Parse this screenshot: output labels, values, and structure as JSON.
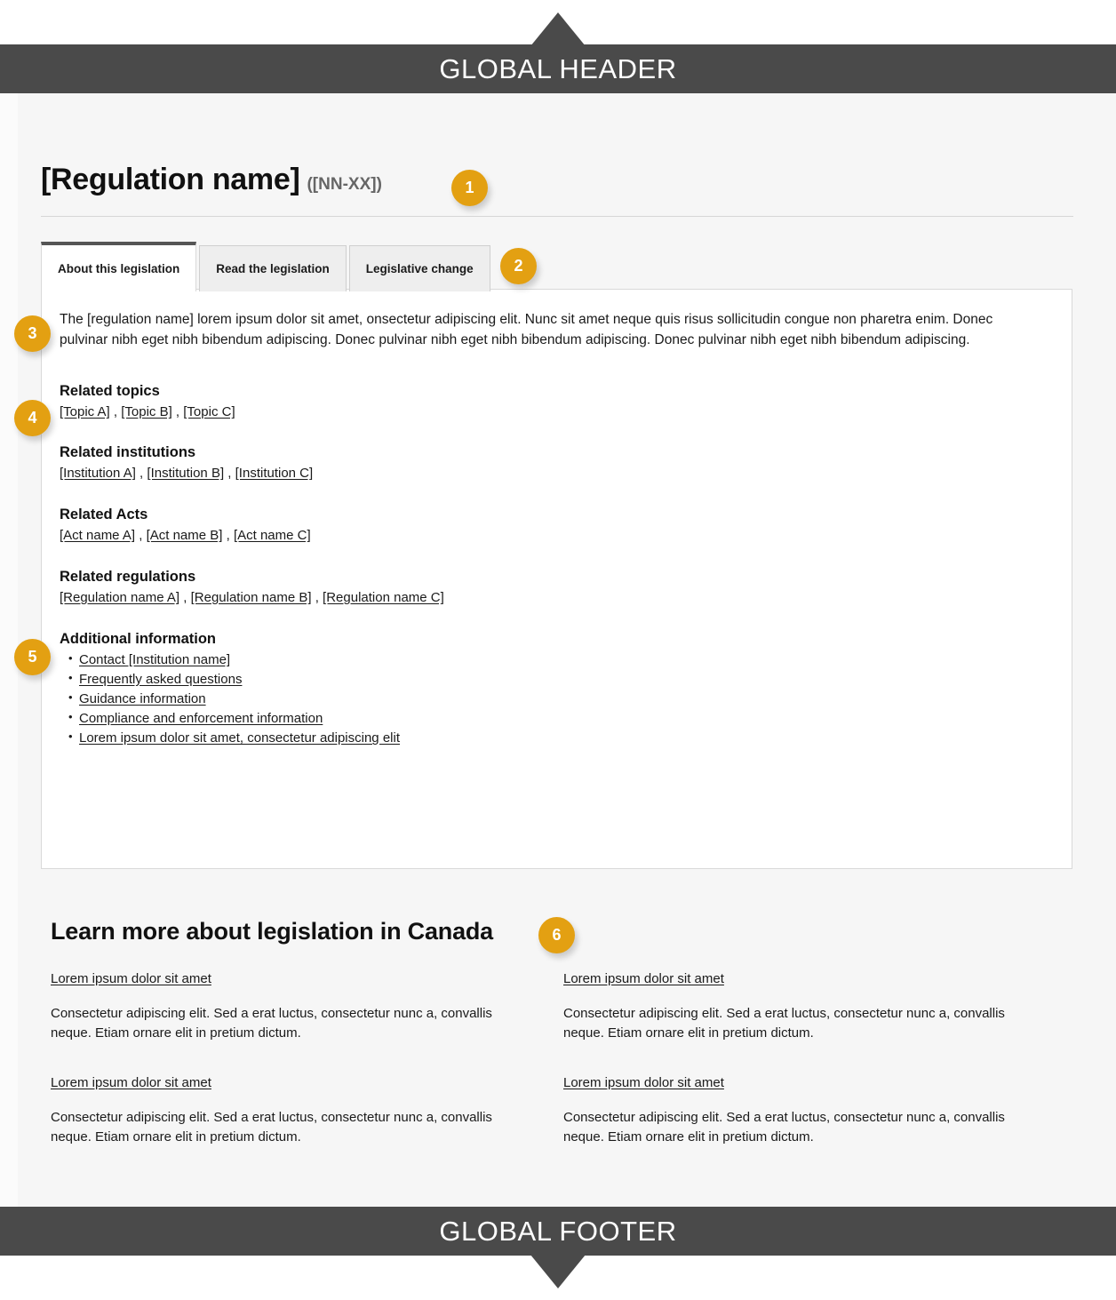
{
  "global": {
    "header_label": "GLOBAL HEADER",
    "footer_label": "GLOBAL FOOTER",
    "bar_color": "#4a4a4a",
    "badge_color": "#e3a012"
  },
  "title": {
    "name": "[Regulation name]",
    "code": "([NN-XX])"
  },
  "tabs": [
    {
      "label": "About this legislation",
      "active": true
    },
    {
      "label": "Read the legislation",
      "active": false
    },
    {
      "label": "Legislative change",
      "active": false
    }
  ],
  "content": {
    "lead_paragraph": "The [regulation name] lorem ipsum dolor sit amet, onsectetur adipiscing elit. Nunc sit amet neque quis risus sollicitudin congue non pharetra enim. Donec pulvinar nibh eget nibh bibendum adipiscing. Donec pulvinar nibh eget nibh bibendum adipiscing. Donec pulvinar nibh eget nibh bibendum adipiscing.",
    "sections": [
      {
        "heading": "Related topics",
        "links": [
          "[Topic A]",
          "[Topic B]",
          "[Topic C]"
        ]
      },
      {
        "heading": "Related institutions",
        "links": [
          "[Institution A]",
          "[Institution B]",
          "[Institution C]"
        ]
      },
      {
        "heading": "Related Acts",
        "links": [
          "[Act name A]",
          "[Act name B]",
          "[Act name C]"
        ]
      },
      {
        "heading": "Related regulations",
        "links": [
          "[Regulation name A]",
          "[Regulation name B]",
          "[Regulation name C]"
        ]
      }
    ],
    "additional": {
      "heading": "Additional information",
      "items": [
        "Contact [Institution name]",
        "Frequently asked questions",
        "Guidance information",
        "Compliance and enforcement information",
        "Lorem ipsum dolor sit amet, consectetur adipiscing elit"
      ]
    },
    "separator": " , "
  },
  "learn_more": {
    "heading": "Learn more about legislation in Canada",
    "cards": [
      {
        "link": "Lorem ipsum dolor sit amet",
        "body": "Consectetur adipiscing elit. Sed a erat luctus, consectetur nunc a, convallis neque. Etiam ornare elit in pretium dictum."
      },
      {
        "link": "Lorem ipsum dolor sit amet",
        "body": "Consectetur adipiscing elit. Sed a erat luctus, consectetur nunc a, convallis neque. Etiam ornare elit in pretium dictum."
      },
      {
        "link": "Lorem ipsum dolor sit amet",
        "body": "Consectetur adipiscing elit. Sed a erat luctus, consectetur nunc a, convallis neque. Etiam ornare elit in pretium dictum."
      },
      {
        "link": "Lorem ipsum dolor sit amet",
        "body": "Consectetur adipiscing elit. Sed a erat luctus, consectetur nunc a, convallis neque. Etiam ornare elit in pretium dictum."
      }
    ]
  },
  "callouts": [
    {
      "id": "1",
      "number": "1"
    },
    {
      "id": "2",
      "number": "2"
    },
    {
      "id": "3",
      "number": "3"
    },
    {
      "id": "4",
      "number": "4"
    },
    {
      "id": "5",
      "number": "5"
    },
    {
      "id": "6",
      "number": "6"
    }
  ]
}
